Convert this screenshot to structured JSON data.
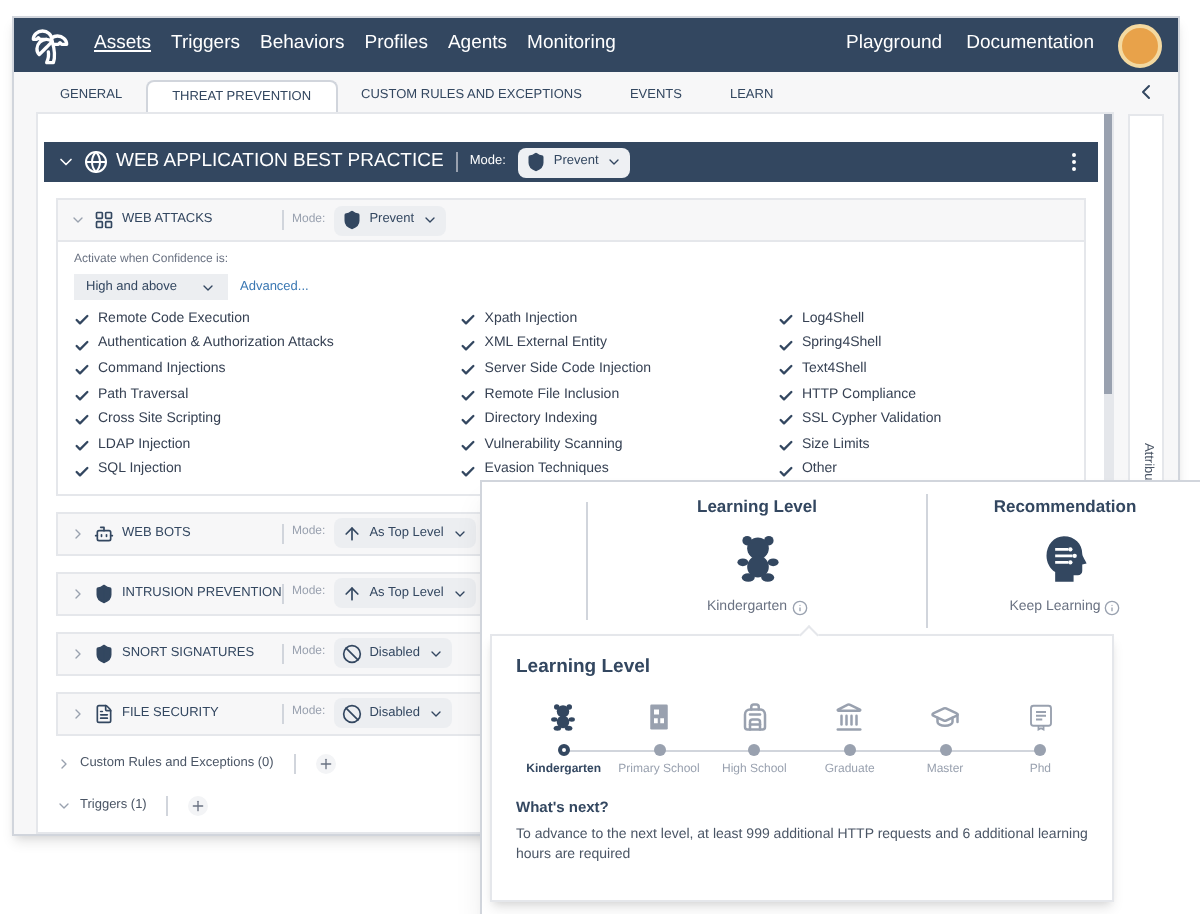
{
  "nav": {
    "items": [
      {
        "label": "Assets",
        "selected": true
      },
      {
        "label": "Triggers",
        "selected": false
      },
      {
        "label": "Behaviors",
        "selected": false
      },
      {
        "label": "Profiles",
        "selected": false
      },
      {
        "label": "Agents",
        "selected": false
      },
      {
        "label": "Monitoring",
        "selected": false
      }
    ],
    "right": [
      "Playground",
      "Documentation"
    ]
  },
  "tabs": [
    {
      "label": "GENERAL",
      "selected": false
    },
    {
      "label": "THREAT PREVENTION",
      "selected": true
    },
    {
      "label": "CUSTOM RULES AND EXCEPTIONS",
      "selected": false
    },
    {
      "label": "EVENTS",
      "selected": false
    },
    {
      "label": "LEARN",
      "selected": false
    }
  ],
  "practice": {
    "title": "WEB APPLICATION BEST PRACTICE",
    "expanded": true,
    "mode_label": "Mode:",
    "mode": {
      "kind": "prevent",
      "label": "Prevent"
    }
  },
  "sections": [
    {
      "title": "WEB ATTACKS",
      "expanded": true,
      "mode_label": "Mode:",
      "mode": {
        "kind": "prevent",
        "label": "Prevent"
      }
    },
    {
      "title": "WEB BOTS",
      "expanded": false,
      "mode_label": "Mode:",
      "mode": {
        "kind": "inherit",
        "label": "As Top Level"
      }
    },
    {
      "title": "INTRUSION PREVENTION",
      "expanded": false,
      "mode_label": "Mode:",
      "mode": {
        "kind": "inherit",
        "label": "As Top Level"
      }
    },
    {
      "title": "SNORT SIGNATURES",
      "expanded": false,
      "mode_label": "Mode:",
      "mode": {
        "kind": "disabled",
        "label": "Disabled"
      }
    },
    {
      "title": "FILE SECURITY",
      "expanded": false,
      "mode_label": "Mode:",
      "mode": {
        "kind": "disabled",
        "label": "Disabled"
      }
    }
  ],
  "web_attacks": {
    "confidence_label": "Activate when Confidence is:",
    "confidence": "High and above",
    "advanced_link": "Advanced...",
    "protections": [
      {
        "label": "Remote Code Execution",
        "checked": true
      },
      {
        "label": "Authentication & Authorization Attacks",
        "checked": true
      },
      {
        "label": "Command Injections",
        "checked": true
      },
      {
        "label": "Path Traversal",
        "checked": true
      },
      {
        "label": "Cross Site Scripting",
        "checked": true
      },
      {
        "label": "LDAP Injection",
        "checked": true
      },
      {
        "label": "SQL Injection",
        "checked": true
      },
      {
        "label": "Xpath Injection",
        "checked": true
      },
      {
        "label": "XML External Entity",
        "checked": true
      },
      {
        "label": "Server Side Code Injection",
        "checked": true
      },
      {
        "label": "Remote File Inclusion",
        "checked": true
      },
      {
        "label": "Directory Indexing",
        "checked": true
      },
      {
        "label": "Vulnerability Scanning",
        "checked": true
      },
      {
        "label": "Evasion Techniques",
        "checked": true
      },
      {
        "label": "Log4Shell",
        "checked": true
      },
      {
        "label": "Spring4Shell",
        "checked": true
      },
      {
        "label": "Text4Shell",
        "checked": true
      },
      {
        "label": "HTTP Compliance",
        "checked": true
      },
      {
        "label": "SSL Cypher Validation",
        "checked": true
      },
      {
        "label": "Size Limits",
        "checked": true
      },
      {
        "label": "Other",
        "checked": true
      }
    ]
  },
  "footer_items": [
    {
      "label": "Custom Rules and Exceptions (0)",
      "expanded": false
    },
    {
      "label": "Triggers (1)",
      "expanded": true
    }
  ],
  "side_panel": {
    "label": "Attribu"
  },
  "overlay": {
    "columns": [
      {
        "title": "Learning Level",
        "value": "Kindergarten"
      },
      {
        "title": "Recommendation",
        "value": "Keep Learning"
      }
    ],
    "popover": {
      "title": "Learning Level",
      "levels": [
        {
          "label": "Kindergarten",
          "selected": true
        },
        {
          "label": "Primary School",
          "selected": false
        },
        {
          "label": "High School",
          "selected": false
        },
        {
          "label": "Graduate",
          "selected": false
        },
        {
          "label": "Master",
          "selected": false
        },
        {
          "label": "Phd",
          "selected": false
        }
      ],
      "next_title": "What's next?",
      "next_text": "To advance to the next level, at least 999 additional HTTP requests and 6 additional learning hours are required"
    }
  }
}
